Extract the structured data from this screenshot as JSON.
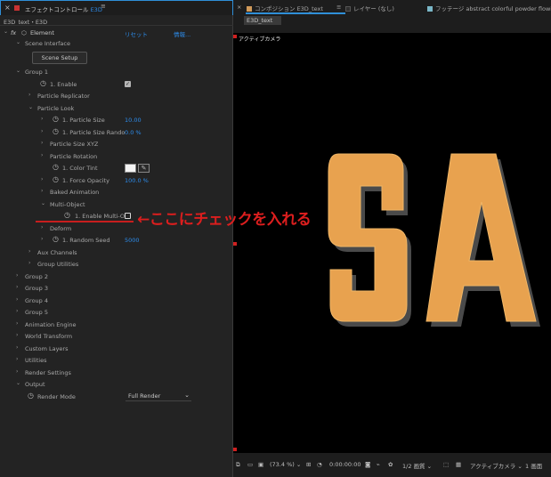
{
  "effect_panel": {
    "close_glyph": "×",
    "title": "エフェクトコントロール",
    "layer": "E3D",
    "menu_glyph": "≡",
    "subtitle": "E3D_text・E3D",
    "fx_label": "fx",
    "effect_name": "Element",
    "reset_label": "リセット",
    "info_label": "情報..."
  },
  "rows": {
    "scene_interface": "Scene Interface",
    "scene_setup": "Scene Setup",
    "group1": "Group 1",
    "enable": "1. Enable",
    "particle_replicator": "Particle Replicator",
    "particle_look": "Particle Look",
    "particle_size": "1. Particle Size",
    "particle_size_value": "10.00",
    "particle_size_rando": "1. Particle Size Rando",
    "particle_size_rando_value": "0.0 %",
    "particle_size_xyz": "Particle Size XYZ",
    "particle_rotation": "Particle Rotation",
    "color_tint": "1. Color Tint",
    "eyedropper_glyph": "✎",
    "force_opacity": "1. Force Opacity",
    "force_opacity_value": "100.0 %",
    "baked_animation": "Baked Animation",
    "multi_object": "Multi-Object",
    "enable_multi": "1. Enable Multi-O",
    "deform": "Deform",
    "random_seed": "1. Random Seed",
    "random_seed_value": "5000",
    "aux_channels": "Aux Channels",
    "group_utilities": "Group Utilities",
    "group2": "Group 2",
    "group3": "Group 3",
    "group4": "Group 4",
    "group5": "Group 5",
    "animation_engine": "Animation Engine",
    "world_transform": "World Transform",
    "custom_layers": "Custom Layers",
    "utilities": "Utilities",
    "render_settings": "Render Settings",
    "output": "Output",
    "render_mode": "Render Mode",
    "render_mode_value": "Full Render"
  },
  "glyphs": {
    "twirl_open": "⌄",
    "twirl_closed": "›",
    "stopwatch": "◷",
    "check": "✓",
    "dropdown": "⌄"
  },
  "annotation": {
    "text": "←ここにチェックを入れる"
  },
  "comp_panel": {
    "close_glyph": "×",
    "comp_tab": "コンポジション E3D_text",
    "comp_menu": "≡",
    "layer_tab": "レイヤー (なし)",
    "footage_tab": "フッテージ abstract colorful powder flowing throu",
    "comp_name": "E3D_text",
    "active_camera": "アクティブカメラ",
    "viewer_text": "SA"
  },
  "footer": {
    "zoom": "(73.4 %)",
    "zoom_arrow": "⌄",
    "timecode": "0:00:00:00",
    "resolution": "1/2 画質",
    "resolution_arrow": "⌄",
    "camera": "アクティブカメラ",
    "camera_arrow": "⌄",
    "views": "1 画面"
  },
  "colors": {
    "accent_blue": "#2d8ceb",
    "annotation_red": "#dc1e1e",
    "letter_fill": "#e8a24f",
    "letter_side": "#4a4a4a"
  }
}
